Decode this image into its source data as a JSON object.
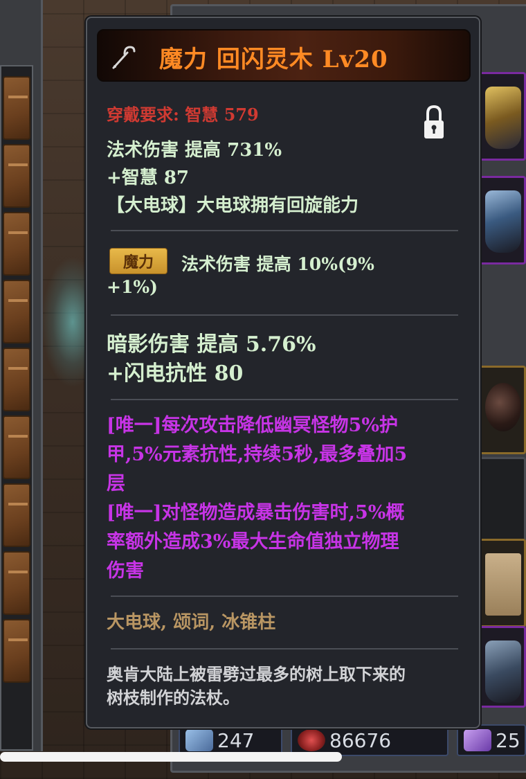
{
  "tooltip": {
    "title": "魔力 回闪灵木 Lv20",
    "title_icon": "staff-icon",
    "lock_icon": "lock-icon",
    "requirement": "穿戴要求: 智慧 579",
    "base_stats": [
      "法术伤害 提高 731%",
      "+智慧 87",
      "【大电球】大电球拥有回旋能力"
    ],
    "affix": {
      "badge": "魔力",
      "line1": "法术伤害 提高 10%(9%",
      "line2": "+1%)"
    },
    "extra_stats": [
      "暗影伤害 提高 5.76%",
      "+闪电抗性 80"
    ],
    "unique_lines": [
      "[唯一]每次攻击降低幽冥怪物5%护",
      "甲,5%元素抗性,持续5秒,最多叠加5",
      "层",
      "[唯一]对怪物造成暴击伤害时,5%概",
      "率额外造成3%最大生命值独立物理",
      "伤害"
    ],
    "skills": "大电球, 颂词, 冰锥柱",
    "flavor_lines": [
      "奥肯大陆上被雷劈过最多的树上取下来的",
      "树枝制作的法杖。"
    ]
  },
  "stats_bar": {
    "attack": "247",
    "health": "86676",
    "gems": "25"
  },
  "colors": {
    "title": "#ff8a24",
    "requirement": "#d03a32",
    "stat_text": "#d5efcf",
    "unique_text": "#c734e6",
    "skills_text": "#b99663",
    "badge": "#e0ae3e",
    "tooltip_bg": "#23252b"
  }
}
